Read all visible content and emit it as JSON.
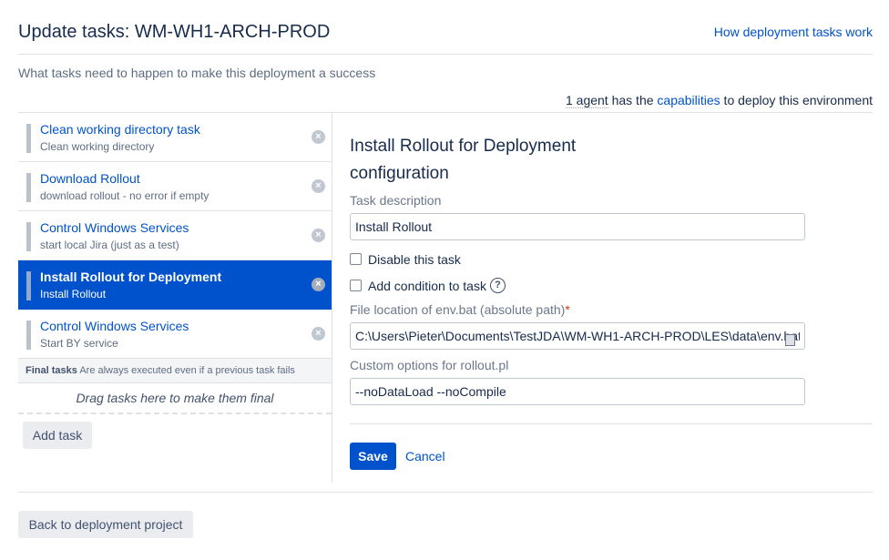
{
  "header": {
    "title": "Update tasks: WM-WH1-ARCH-PROD",
    "help_link": "How deployment tasks work"
  },
  "subtitle": "What tasks need to happen to make this deployment a success",
  "agents": {
    "count_text": "1 agent",
    "middle_text": " has the ",
    "capabilities_link": "capabilities",
    "suffix_text": " to deploy this environment"
  },
  "tasks": [
    {
      "name": "Clean working directory task",
      "description": "Clean working directory",
      "selected": false
    },
    {
      "name": "Download Rollout",
      "description": "download rollout - no error if empty",
      "selected": false
    },
    {
      "name": "Control Windows Services",
      "description": "start local Jira (just as a test)",
      "selected": false
    },
    {
      "name": "Install Rollout for Deployment",
      "description": "Install Rollout",
      "selected": true
    },
    {
      "name": "Control Windows Services",
      "description": "Start BY service",
      "selected": false
    }
  ],
  "final_tasks": {
    "label": "Final tasks",
    "note": "Are always executed even if a previous task fails",
    "drop_hint": "Drag tasks here to make them final"
  },
  "add_task_label": "Add task",
  "remove_icon": "×",
  "config": {
    "title": "Install Rollout for Deployment configuration",
    "task_description_label": "Task description",
    "task_description_value": "Install Rollout",
    "disable_label": "Disable this task",
    "disable_checked": false,
    "condition_label": "Add condition to task",
    "condition_checked": false,
    "help_icon": "?",
    "file_location_label": "File location of env.bat (absolute path)",
    "required_marker": "*",
    "file_location_value": "C:\\Users\\Pieter\\Documents\\TestJDA\\WM-WH1-ARCH-PROD\\LES\\data\\env.bat",
    "custom_options_label": "Custom options for rollout.pl",
    "custom_options_value": "--noDataLoad --noCompile",
    "save_label": "Save",
    "cancel_label": "Cancel"
  },
  "back_label": "Back to deployment project",
  "colors": {
    "primary": "#0052cc",
    "text": "#172b4d",
    "muted": "#5e6c84",
    "border": "#dfe1e6",
    "required": "#de350b"
  }
}
